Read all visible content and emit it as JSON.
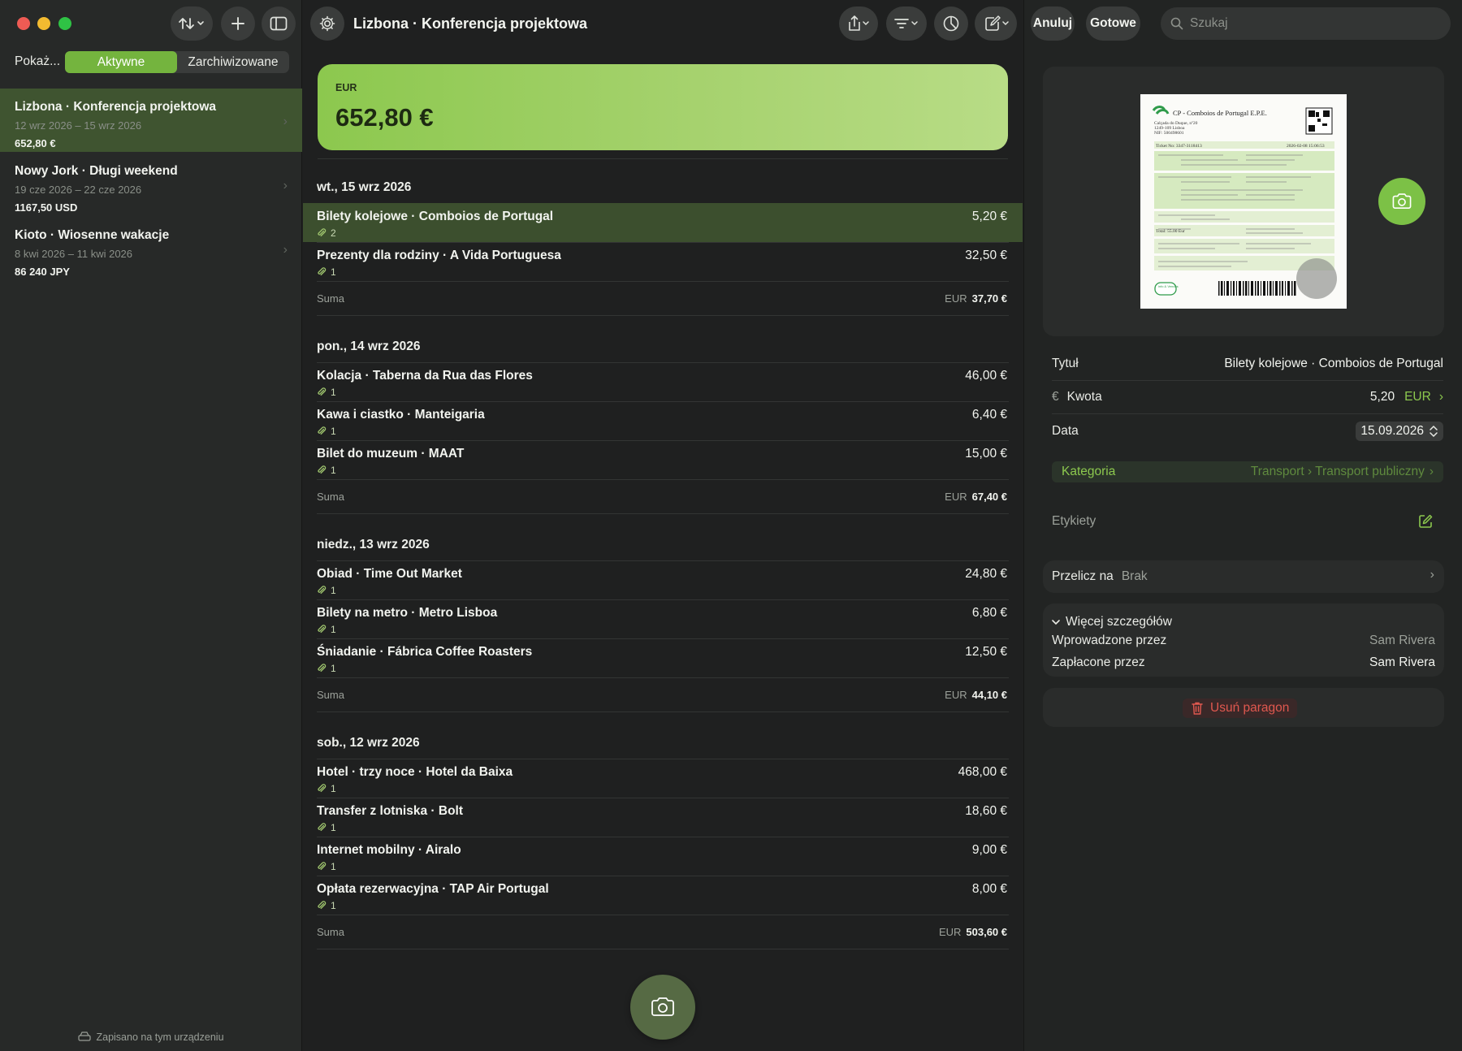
{
  "window": {
    "title": "Lizbona · Konferencja projektowa"
  },
  "sidebar": {
    "show_label": "Pokaż...",
    "segments": [
      "Aktywne",
      "Zarchiwizowane"
    ],
    "active_segment": "Aktywne",
    "trips": [
      {
        "name": "Lizbona · Konferencja projektowa",
        "dates": "12 wrz 2026 – 15 wrz 2026",
        "amount": "652,80 €",
        "active": true
      },
      {
        "name": "Nowy Jork · Długi weekend",
        "dates": "19 cze 2026 – 22 cze 2026",
        "amount": "1167,50 USD",
        "active": false
      },
      {
        "name": "Kioto · Wiosenne wakacje",
        "dates": "8 kwi 2026 – 11 kwi 2026",
        "amount": "86 240 JPY",
        "active": false
      }
    ],
    "saved_note": "Zapisano na tym urządzeniu"
  },
  "main": {
    "total": {
      "currency": "EUR",
      "amount": "652,80 €"
    },
    "sum_label": "Suma",
    "days": [
      {
        "date": "wt., 15 wrz 2026",
        "items": [
          {
            "title": "Bilety kolejowe · Comboios de Portugal",
            "amount": "5,20 €",
            "attachments": "2",
            "selected": true
          },
          {
            "title": "Prezenty dla rodziny · A Vida Portuguesa",
            "amount": "32,50 €",
            "attachments": "1"
          }
        ],
        "sum_currency": "EUR",
        "sum": "37,70 €"
      },
      {
        "date": "pon., 14 wrz 2026",
        "items": [
          {
            "title": "Kolacja · Taberna da Rua das Flores",
            "amount": "46,00 €",
            "attachments": "1"
          },
          {
            "title": "Kawa i ciastko · Manteigaria",
            "amount": "6,40 €",
            "attachments": "1"
          },
          {
            "title": "Bilet do muzeum · MAAT",
            "amount": "15,00 €",
            "attachments": "1"
          }
        ],
        "sum_currency": "EUR",
        "sum": "67,40 €"
      },
      {
        "date": "niedz., 13 wrz 2026",
        "items": [
          {
            "title": "Obiad · Time Out Market",
            "amount": "24,80 €",
            "attachments": "1"
          },
          {
            "title": "Bilety na metro · Metro Lisboa",
            "amount": "6,80 €",
            "attachments": "1"
          },
          {
            "title": "Śniadanie · Fábrica Coffee Roasters",
            "amount": "12,50 €",
            "attachments": "1"
          }
        ],
        "sum_currency": "EUR",
        "sum": "44,10 €"
      },
      {
        "date": "sob., 12 wrz 2026",
        "items": [
          {
            "title": "Hotel · trzy noce · Hotel da Baixa",
            "amount": "468,00 €",
            "attachments": "1"
          },
          {
            "title": "Transfer z lotniska · Bolt",
            "amount": "18,60 €",
            "attachments": "1"
          },
          {
            "title": "Internet mobilny · Airalo",
            "amount": "9,00 €",
            "attachments": "1"
          },
          {
            "title": "Opłata rezerwacyjna · TAP Air Portugal",
            "amount": "8,00 €",
            "attachments": "1"
          }
        ],
        "sum_currency": "EUR",
        "sum": "503,60 €"
      }
    ]
  },
  "toolbar": {
    "cancel_label": "Anuluj",
    "done_label": "Gotowe",
    "search_placeholder": "Szukaj"
  },
  "inspector": {
    "receipt_image": {
      "company": "CP - Comboios de Portugal E.P.E.",
      "address_1": "Calçada do Duque, nº20",
      "address_2": "1249-109 Lisboa",
      "nif": "NIF: 500498601",
      "ticket_no": "Ticket No: 3347-3118413",
      "ticket_date": "2026-02-08 15:06:53",
      "total_line": "Total: 55.00 Eur",
      "badge": "info & Vendas"
    },
    "title_label": "Tytuł",
    "title_value": "Bilety kolejowe · Comboios de Portugal",
    "amount_label": "Kwota",
    "amount_symbol": "€",
    "amount_value": "5,20",
    "amount_currency": "EUR",
    "date_label": "Data",
    "date_value": "15.09.2026",
    "category_label": "Kategoria",
    "category_value": "Transport › Transport publiczny",
    "tags_label": "Etykiety",
    "convert_label": "Przelicz na",
    "convert_value": "Brak",
    "more_details_label": "Więcej szczegółów",
    "entered_by_label": "Wprowadzone przez",
    "entered_by_value": "Sam Rivera",
    "paid_by_label": "Zapłacone przez",
    "paid_by_value": "Sam Rivera",
    "delete_label": "Usuń paragon"
  },
  "colors": {
    "accent": "#8cc84e",
    "selection": "#3f5430",
    "danger": "#e0584f"
  }
}
